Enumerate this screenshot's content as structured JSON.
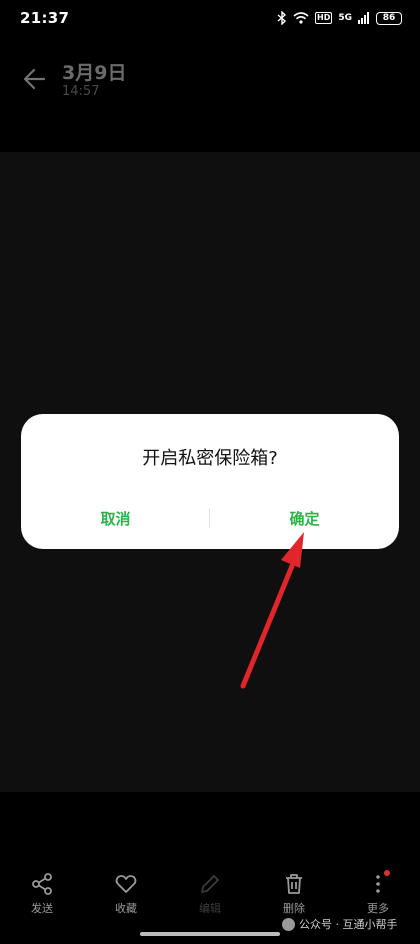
{
  "status_bar": {
    "time": "21:37",
    "hd": "HD",
    "network": "5G",
    "battery": "86"
  },
  "header": {
    "date": "3月9日",
    "time": "14:57"
  },
  "dialog": {
    "title": "开启私密保险箱?",
    "cancel_label": "取消",
    "confirm_label": "确定",
    "accent_color": "#2db34a"
  },
  "toolbar": {
    "items": [
      {
        "label": "发送",
        "icon": "share-icon"
      },
      {
        "label": "收藏",
        "icon": "heart-icon"
      },
      {
        "label": "编辑",
        "icon": "pencil-icon"
      },
      {
        "label": "删除",
        "icon": "trash-icon"
      },
      {
        "label": "更多",
        "icon": "more-vertical-icon"
      }
    ]
  },
  "watermark": {
    "text": "公众号 · 互通小帮手"
  },
  "annotation": {
    "arrow_color": "#e0262b"
  }
}
